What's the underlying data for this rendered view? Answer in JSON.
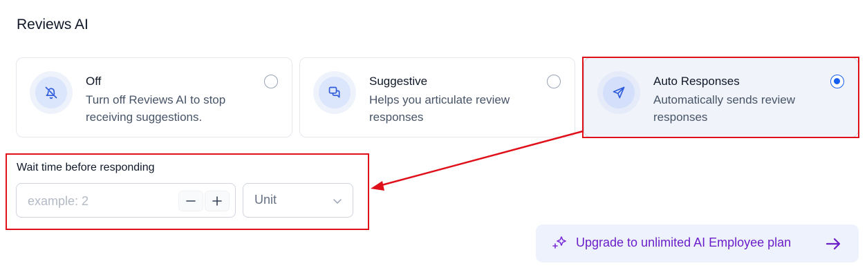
{
  "page": {
    "title": "Reviews AI"
  },
  "options": [
    {
      "title": "Off",
      "description": "Turn off Reviews AI to stop receiving suggestions.",
      "icon": "bell-off-icon",
      "selected": false
    },
    {
      "title": "Suggestive",
      "description": "Helps you articulate review responses",
      "icon": "chat-bubbles-icon",
      "selected": false
    },
    {
      "title": "Auto Responses",
      "description": "Automatically sends review responses",
      "icon": "send-icon",
      "selected": true
    }
  ],
  "wait_time": {
    "label": "Wait time before responding",
    "placeholder": "example: 2",
    "value": "",
    "unit_value": "Unit"
  },
  "upgrade": {
    "label": "Upgrade to unlimited AI Employee plan"
  },
  "colors": {
    "accent": "#155eef",
    "upgrade_text": "#6a1fc9",
    "highlight": "#e0101a"
  }
}
